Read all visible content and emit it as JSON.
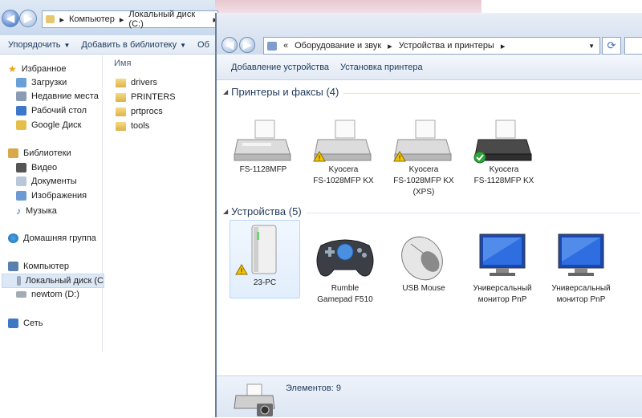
{
  "explorer": {
    "breadcrumb": [
      "Компьютер",
      "Локальный диск (C:)"
    ],
    "toolbar": {
      "organize": "Упорядочить",
      "add_to_library": "Добавить в библиотеку",
      "share": "Об"
    },
    "column_name": "Имя",
    "nav": {
      "favorites": "Избранное",
      "downloads": "Загрузки",
      "recent": "Недавние места",
      "desktop": "Рабочий стол",
      "gdrive": "Google Диск",
      "libraries": "Библиотеки",
      "video": "Видео",
      "documents": "Документы",
      "images": "Изображения",
      "music": "Музыка",
      "homegroup": "Домашняя группа",
      "computer": "Компьютер",
      "local_disk": "Локальный диск (C",
      "newtom": "newtom (D:)",
      "network": "Сеть"
    },
    "files": [
      "drivers",
      "PRINTERS",
      "prtprocs",
      "tools"
    ]
  },
  "window": {
    "breadcrumb": {
      "prefix": "«",
      "part1": "Оборудование и звук",
      "part2": "Устройства и принтеры"
    },
    "commands": {
      "add_device": "Добавление устройства",
      "add_printer": "Установка принтера"
    },
    "printers_group": "Принтеры и факсы (4)",
    "devices_group": "Устройства (5)",
    "printers": [
      {
        "line1": "FS-1128MFP",
        "line2": "",
        "line3": "",
        "status": "none",
        "color": "gray"
      },
      {
        "line1": "Kyocera",
        "line2": "FS-1028MFP KX",
        "line3": "",
        "status": "warning",
        "color": "gray"
      },
      {
        "line1": "Kyocera",
        "line2": "FS-1028MFP KX",
        "line3": "(XPS)",
        "status": "warning",
        "color": "gray"
      },
      {
        "line1": "Kyocera",
        "line2": "FS-1128MFP KX",
        "line3": "",
        "status": "default",
        "color": "dark"
      }
    ],
    "devices": [
      {
        "line1": "23-PC",
        "line2": "",
        "kind": "computer",
        "status": "warning"
      },
      {
        "line1": "Rumble",
        "line2": "Gamepad F510",
        "kind": "gamepad",
        "status": "none"
      },
      {
        "line1": "USB Mouse",
        "line2": "",
        "kind": "mouse",
        "status": "none"
      },
      {
        "line1": "Универсальный",
        "line2": "монитор PnP",
        "kind": "monitor",
        "status": "none"
      },
      {
        "line1": "Универсальный",
        "line2": "монитор PnP",
        "kind": "monitor",
        "status": "none"
      }
    ],
    "status_text": "Элементов: 9"
  },
  "colors": {
    "accent": "#1e395b",
    "warning": "#f5c400",
    "ok": "#2ea43a",
    "selection": "#e2eefc"
  }
}
